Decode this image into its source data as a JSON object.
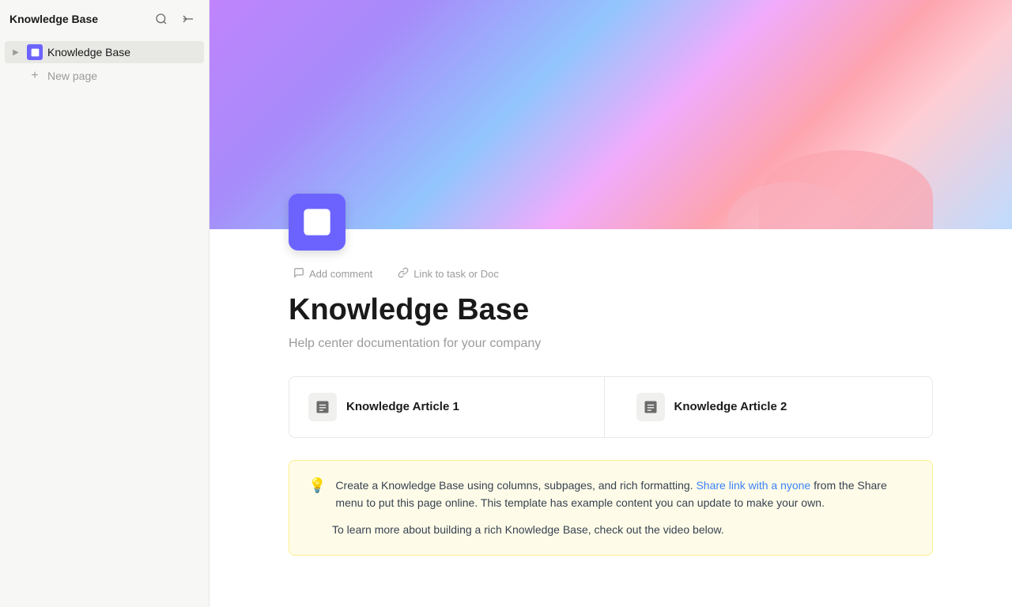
{
  "sidebar": {
    "title": "Knowledge Base",
    "search_label": "Search",
    "collapse_label": "Collapse sidebar",
    "nav_items": [
      {
        "id": "knowledge-base",
        "label": "Knowledge Base",
        "active": true
      }
    ],
    "new_page_label": "New page"
  },
  "header": {
    "banner_alt": "Colorful gradient banner"
  },
  "page": {
    "icon_alt": "Knowledge base document icon",
    "add_comment_label": "Add comment",
    "link_to_task_label": "Link to task or Doc",
    "title": "Knowledge Base",
    "subtitle": "Help center documentation for your company"
  },
  "cards": [
    {
      "label": "Knowledge Article 1"
    },
    {
      "label": "Knowledge Article 2"
    }
  ],
  "info_box": {
    "intro_text": "Create a Knowledge Base using columns, subpages, and rich formatting.",
    "link_text": "Share link with a nyone",
    "after_link_text": " from the Share menu to put this page online. This template has example content you can update to make your own.",
    "second_line": "To learn more about building a rich Knowledge Base, check out the video below."
  }
}
